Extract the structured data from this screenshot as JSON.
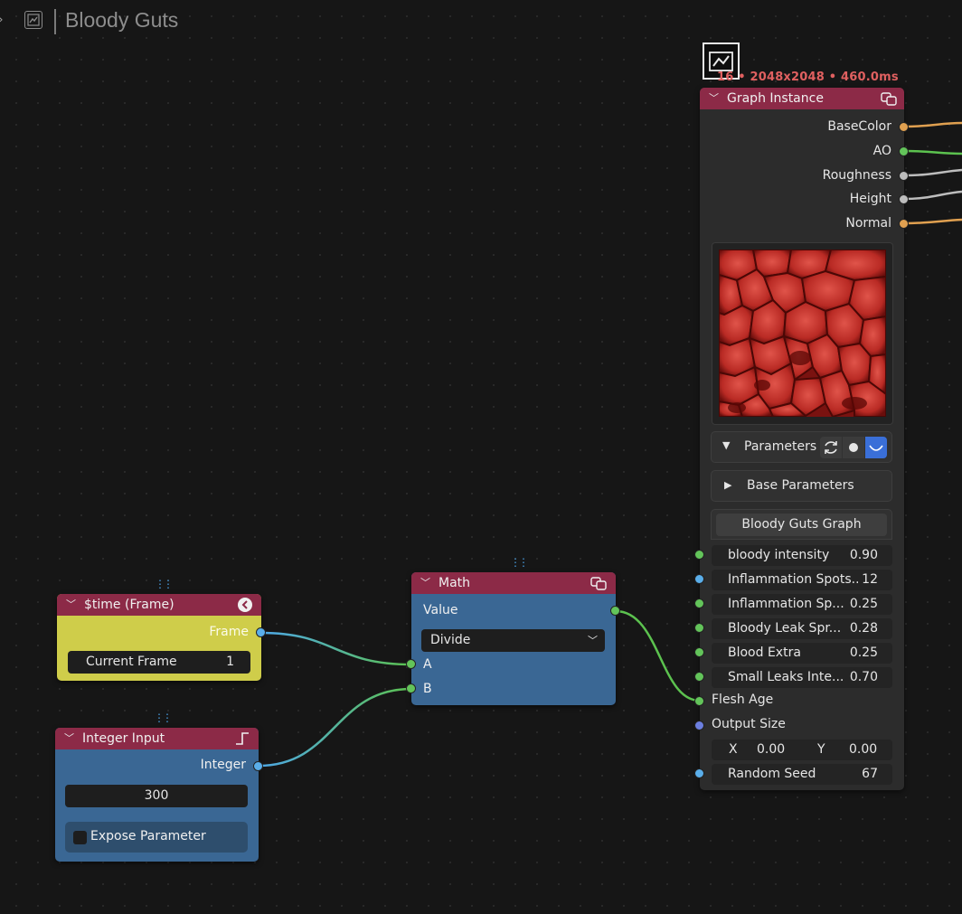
{
  "header": {
    "title": "Bloody Guts"
  },
  "colors": {
    "node_header": "#8c2a47",
    "time_body": "#cfcd4a",
    "blue_body": "#3a6794",
    "graph_body": "#2c2c2c",
    "wire_green": "#5cc24f",
    "wire_blue": "#4ea8e8",
    "wire_orange": "#e0a050",
    "wire_grey": "#bdbdbd",
    "stats_red": "#e06060"
  },
  "time_node": {
    "title": "$time (Frame)",
    "output_label": "Frame",
    "field_label": "Current Frame",
    "field_value": "1"
  },
  "int_node": {
    "title": "Integer Input",
    "output_label": "Integer",
    "value": "300",
    "expose_label": "Expose Parameter"
  },
  "math_node": {
    "title": "Math",
    "output_label": "Value",
    "operation": "Divide",
    "input_a": "A",
    "input_b": "B"
  },
  "graph_instance": {
    "stats": "16 • 2048x2048 • 460.0ms",
    "title": "Graph Instance",
    "outputs": [
      "BaseColor",
      "AO",
      "Roughness",
      "Height",
      "Normal"
    ],
    "parameters_label": "Parameters",
    "base_parameters_label": "Base Parameters",
    "graph_button": "Bloody Guts Graph",
    "params": [
      {
        "label": "bloody intensity",
        "value": "0.90"
      },
      {
        "label": "Inflammation Spots...",
        "value": "12"
      },
      {
        "label": "Inflammation Sp...",
        "value": "0.25"
      },
      {
        "label": "Bloody Leak Spr...",
        "value": "0.28"
      },
      {
        "label": "Blood Extra",
        "value": "0.25"
      },
      {
        "label": "Small Leaks Inte...",
        "value": "0.70"
      }
    ],
    "flesh_age_label": "Flesh Age",
    "output_size_label": "Output Size",
    "x_label": "X",
    "x_value": "0.00",
    "y_label": "Y",
    "y_value": "0.00",
    "seed_label": "Random Seed",
    "seed_value": "67"
  }
}
